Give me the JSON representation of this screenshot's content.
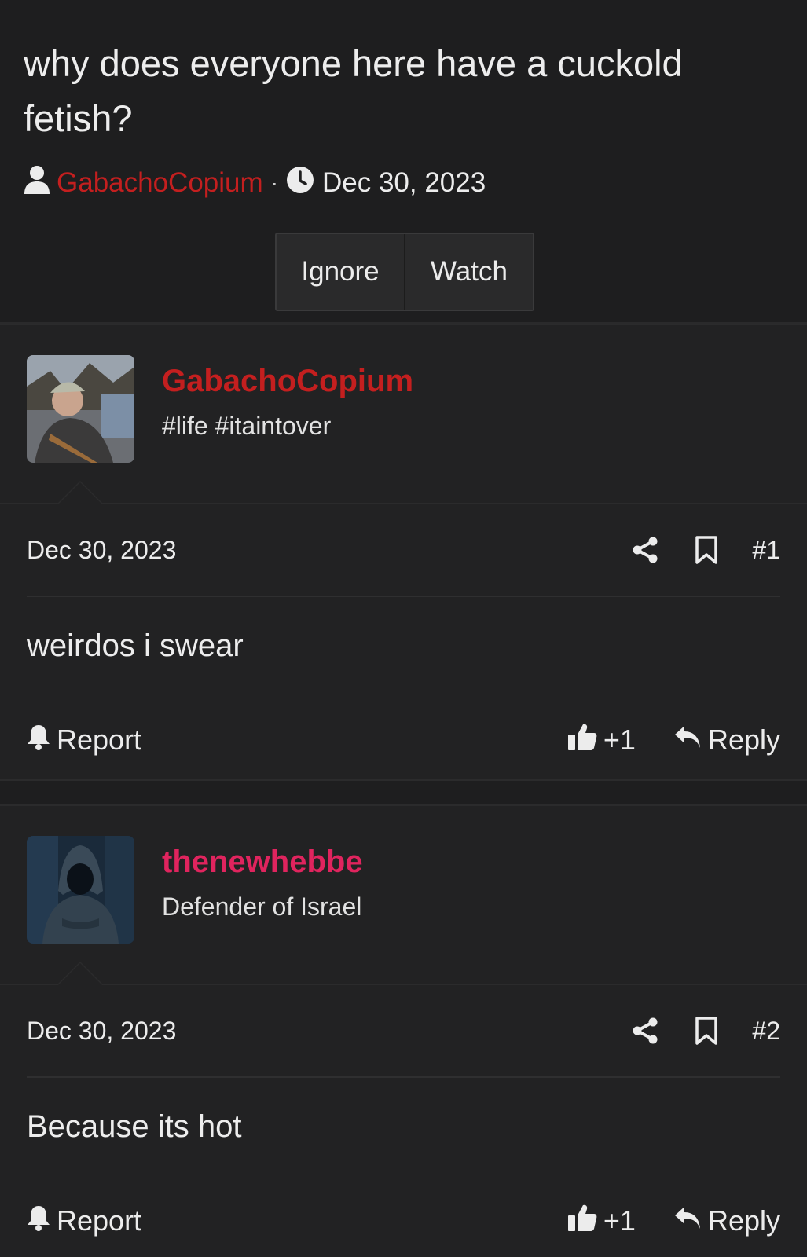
{
  "thread": {
    "title": "why does everyone here have a cuckold fetish?",
    "author": "GabachoCopium",
    "separator": "·",
    "date": "Dec 30, 2023",
    "ignore_label": "Ignore",
    "watch_label": "Watch"
  },
  "posts": [
    {
      "username": "GabachoCopium",
      "username_color": "#c41f1f",
      "user_title": "#life #itaintover",
      "date": "Dec 30, 2023",
      "number": "#1",
      "content": "weirdos i swear",
      "report_label": "Report",
      "reaction_count": "+1",
      "reply_label": "Reply"
    },
    {
      "username": "thenewhebbe",
      "username_color": "#e0245e",
      "user_title": "Defender of Israel",
      "date": "Dec 30, 2023",
      "number": "#2",
      "content": "Because its hot",
      "report_label": "Report",
      "reaction_count": "+1",
      "reply_label": "Reply"
    }
  ],
  "icons": [
    "user-icon",
    "clock-icon",
    "share-icon",
    "bookmark-icon",
    "bell-icon",
    "thumbs-up-icon",
    "reply-icon"
  ]
}
